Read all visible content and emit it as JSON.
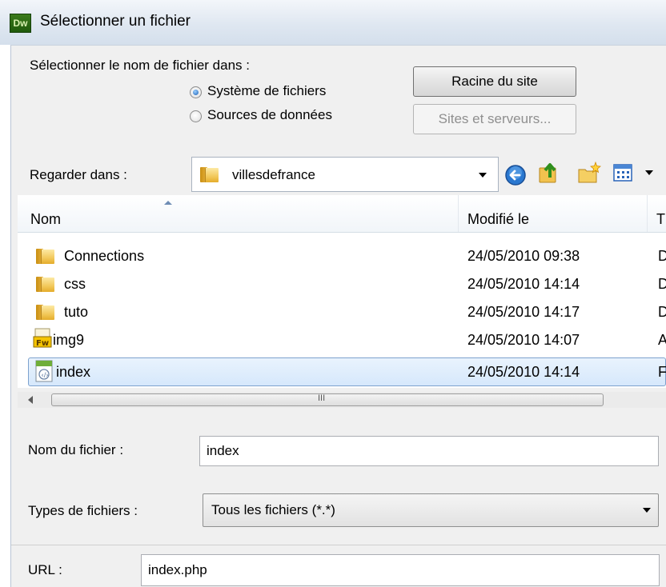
{
  "window": {
    "title": "Sélectionner un fichier",
    "app_badge": "Dw"
  },
  "source": {
    "label": "Sélectionner le nom de fichier dans :",
    "options": [
      {
        "label": "Système de fichiers",
        "selected": true
      },
      {
        "label": "Sources de données",
        "selected": false
      }
    ],
    "site_root_button": "Racine du site",
    "sites_servers_button": "Sites et serveurs..."
  },
  "lookin": {
    "label": "Regarder dans :",
    "value": "villesdefrance",
    "tool_icons": [
      "back-icon",
      "up-folder-icon",
      "new-folder-icon",
      "view-menu-icon"
    ]
  },
  "file_list": {
    "columns": [
      "Nom",
      "Modifié le",
      "T"
    ],
    "rows": [
      {
        "name": "Connections",
        "modified": "24/05/2010 09:38",
        "type": "D",
        "icon": "folder-icon",
        "selected": false
      },
      {
        "name": "css",
        "modified": "24/05/2010 14:14",
        "type": "D",
        "icon": "folder-icon",
        "selected": false
      },
      {
        "name": "tuto",
        "modified": "24/05/2010 14:17",
        "type": "D",
        "icon": "folder-icon",
        "selected": false
      },
      {
        "name": "img9",
        "modified": "24/05/2010 14:07",
        "type": "A",
        "icon": "fireworks-file-icon",
        "selected": false
      },
      {
        "name": "index",
        "modified": "24/05/2010 14:14",
        "type": "F",
        "icon": "php-file-icon",
        "selected": true
      }
    ],
    "scroll_grip": "III"
  },
  "filename": {
    "label": "Nom du fichier :",
    "value": "index"
  },
  "filetypes": {
    "label": "Types de fichiers :",
    "value": "Tous les fichiers (*.*)"
  },
  "url": {
    "label": "URL :",
    "value": "index.php"
  },
  "colors": {
    "selection": "#d6e8fc",
    "selection_border": "#7da2ce",
    "dialog_bg": "#f0f0f0"
  }
}
